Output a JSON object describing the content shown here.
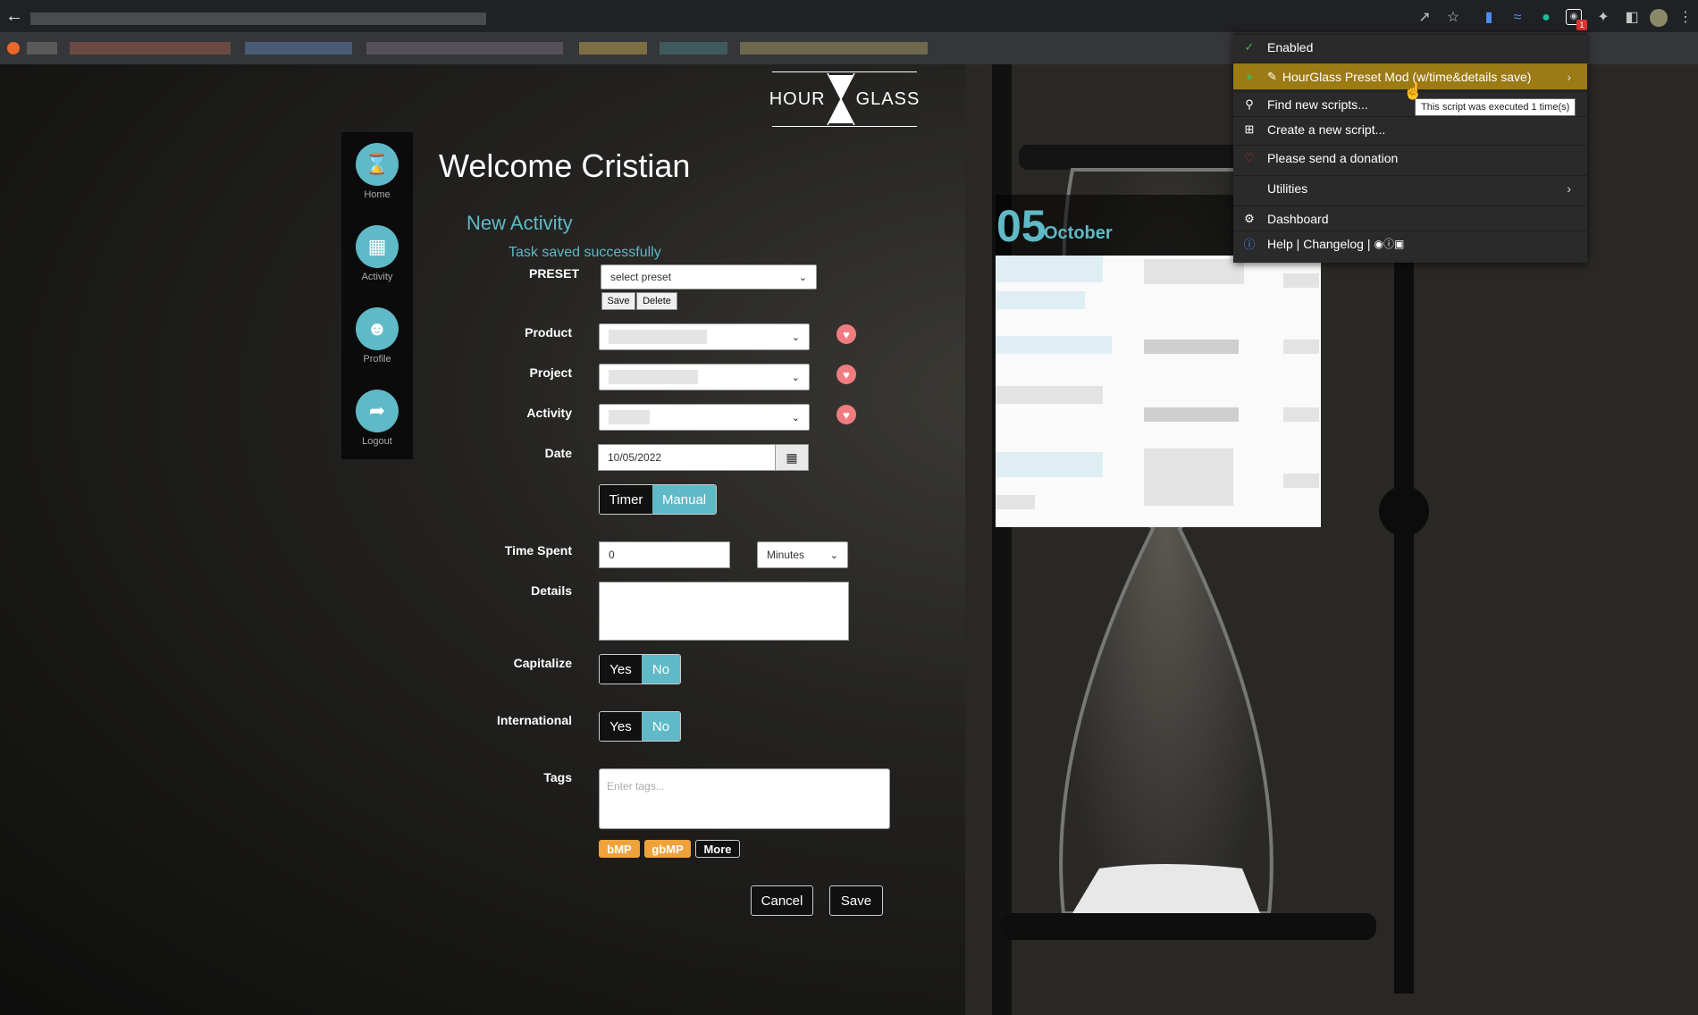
{
  "browser": {
    "back_icon": "arrow-left-icon",
    "toolbar_icons": [
      "share-icon",
      "star-icon",
      "extension-icon",
      "extension-icon",
      "grammarly-icon",
      "tampermonkey-icon",
      "puzzle-icon",
      "sidepanel-icon",
      "avatar",
      "kebab-menu-icon"
    ],
    "tampermonkey_badge": "1"
  },
  "logo": {
    "left": "HOUR",
    "right": "GLASS"
  },
  "sidebar": {
    "items": [
      {
        "label": "Home",
        "icon": "hourglass-icon"
      },
      {
        "label": "Activity",
        "icon": "calendar-icon"
      },
      {
        "label": "Profile",
        "icon": "user-icon"
      },
      {
        "label": "Logout",
        "icon": "exit-icon"
      }
    ]
  },
  "main": {
    "welcome": "Welcome Cristian",
    "section_title": "New Activity",
    "success_message": "Task saved successfully",
    "preset": {
      "label": "PRESET",
      "placeholder": "select preset",
      "save_label": "Save",
      "delete_label": "Delete"
    },
    "product_label": "Product",
    "project_label": "Project",
    "activity_label": "Activity",
    "date_label": "Date",
    "date_value": "10/05/2022",
    "mode": {
      "timer": "Timer",
      "manual": "Manual",
      "selected": "Manual"
    },
    "time_spent_label": "Time Spent",
    "time_spent_value": "0",
    "time_unit": "Minutes",
    "details_label": "Details",
    "capitalize": {
      "label": "Capitalize",
      "yes": "Yes",
      "no": "No",
      "selected": "No"
    },
    "international": {
      "label": "International",
      "yes": "Yes",
      "no": "No",
      "selected": "No"
    },
    "tags": {
      "label": "Tags",
      "placeholder": "Enter tags...",
      "chips": [
        "bMP",
        "gbMP"
      ],
      "more_label": "More"
    },
    "cancel_label": "Cancel",
    "save_label": "Save"
  },
  "calendar": {
    "day": "05",
    "month": "October"
  },
  "tampermonkey_menu": {
    "items": [
      {
        "label": "Enabled",
        "icon": "check-icon"
      },
      {
        "label": "HourGlass Preset Mod (w/time&details save)",
        "icon": "pencil-icon"
      },
      {
        "label": "Find new scripts...",
        "icon": "search-icon"
      },
      {
        "label": "Create a new script...",
        "icon": "plus-square-icon"
      },
      {
        "label": "Please send a donation",
        "icon": "heart-icon"
      },
      {
        "label": "Utilities",
        "icon": ""
      },
      {
        "label": "Dashboard",
        "icon": "gear-icon"
      },
      {
        "label": "Help | Changelog |",
        "icon": "info-icon"
      }
    ],
    "tooltip": "This script was executed 1 time(s)"
  },
  "colors": {
    "accent": "#5fb9c6",
    "heart": "#f07c80",
    "tag_chip": "#f0a23a",
    "menu_active": "#9c7a14"
  }
}
